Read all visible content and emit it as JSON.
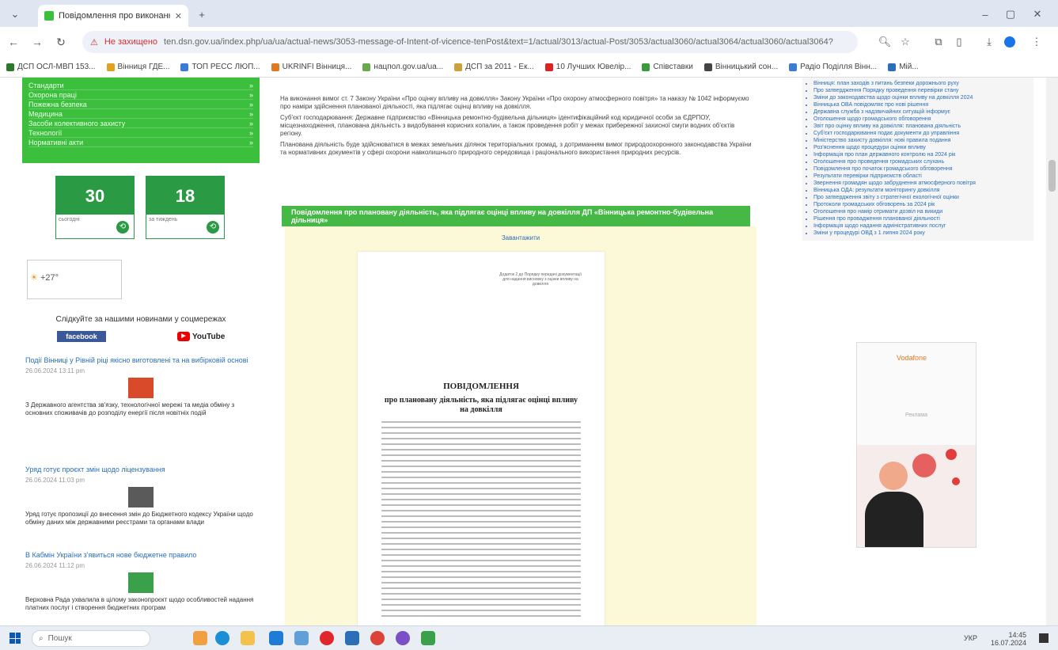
{
  "browser": {
    "tab_title": "Повідомлення про виконання",
    "new_tab": "+",
    "address_warning": "Не захищено",
    "address_url": "ten.dsn.gov.ua/index.php/ua/ua/actual-news/3053-message-of-Intent-of-vicence-tenPost&text=1/actual/3013/actual-Post/3053/actual3060/actual3064/actual3060/actual3064?",
    "bookmarks": [
      {
        "label": "ДСП ОСЛ-МВП 153...",
        "color": "#2b7a2b"
      },
      {
        "label": "Вінниця ГДЕ...",
        "color": "#e0a020"
      },
      {
        "label": "ТОП РЕСС ЛЮП...",
        "color": "#3a7bd5"
      },
      {
        "label": "UKRINFI Вінниця...",
        "color": "#e07a20"
      },
      {
        "label": "нацпол.gov.ua/ua...",
        "color": "#6aa84f"
      },
      {
        "label": "ДСП за 2011 - Ек...",
        "color": "#caa13a"
      },
      {
        "label": "10 Лучших Ювелір...",
        "color": "#d22"
      },
      {
        "label": "Співставки",
        "color": "#3b9a3b"
      },
      {
        "label": "Вінницький сон...",
        "color": "#444"
      },
      {
        "label": "Радіо Поділля Вінн...",
        "color": "#3a7bd5"
      },
      {
        "label": "Мій...",
        "color": "#2a6fb7"
      }
    ]
  },
  "left": {
    "menu_items": [
      "Стандарти",
      "Охорона праці",
      "Пожежна безпека",
      "Медицина",
      "Засоби колективного захисту",
      "Технології",
      "Нормативні акти"
    ],
    "counters": [
      {
        "num": "30",
        "foot": "сьогодні"
      },
      {
        "num": "18",
        "foot": "за тиждень"
      }
    ],
    "weather_temp": "+27°",
    "follow_text": "Слідкуйте за нашими новинами у соцмережах",
    "facebook": "facebook",
    "youtube": "YouTube",
    "youtube_play": "▶",
    "news": [
      {
        "title": "Події Вінниці у Рівній ріці якісно виготовлені та на вибірковій основі",
        "date": "26.06.2024 13:11 pm",
        "text": "З Державного агентства зв'язку, технологічної мережі та медіа обміну з основних споживачів до розподілу енергії після новітніх подій"
      },
      {
        "title": "Уряд готує проєкт змін щодо ліцензування",
        "date": "26.06.2024 11:03 pm",
        "text": "Уряд готує пропозиції до внесення змін до Бюджетного кодексу України щодо обміну даних між державними реєстрами та органами влади"
      },
      {
        "title": "В Кабмін України з'явиться нове бюджетне правило",
        "date": "26.06.2024 11:12 pm",
        "text": "Верховна Рада ухвалила в цілому законопроєкт щодо особливостей надання платних послуг і створення бюджетних програм"
      }
    ]
  },
  "main": {
    "intro": [
      "На виконання вимог ст. 7 Закону України «Про оцінку впливу на довкілля» Закону України «Про охорону атмосферного повітря» та наказу № 1042 інформуємо про наміри здійснення планованої діяльності, яка підлягає оцінці впливу на довкілля.",
      "Суб'єкт господарювання: Державне підприємство «Вінницька ремонтно-будівельна дільниця» ідентифікаційний код юридичної особи за ЄДРПОУ, місцезнаходження, планована діяльність з видобування корисних копалин, а також проведення робіт у межах прибережної захисної смуги водних об'єктів регіону.",
      "Планована діяльність буде здійснюватися в межах земельних ділянок територіальних громад, з дотриманням вимог природоохоронного законодавства України та нормативних документів у сфері охорони навколишнього природного середовища і раціонального використання природних ресурсів."
    ],
    "notice_title": "Повідомлення про плановану діяльність, яка підлягає оцінці впливу на довкілля ДП «Вінницька ремонтно-будівельна дільниця»",
    "doc_link": "Завантажити",
    "doc_appendix": "Додаток 2 до Порядку передачі документації для надання висновку з оцінки впливу на довкілля",
    "doc_heading": "ПОВІДОМЛЕННЯ",
    "doc_subheading": "про плановану діяльність, яка підлягає оцінці впливу на довкілля"
  },
  "right": {
    "links": [
      "Вінниця: план заходів з питань безпеки дорожнього руху",
      "Про затвердження Порядку проведення перевірки стану",
      "Зміни до законодавства щодо оцінки впливу на довкілля 2024",
      "Вінницька ОВА повідомляє про нові рішення",
      "Державна служба з надзвичайних ситуацій інформує",
      "Оголошення щодо громадського обговорення",
      "Звіт про оцінку впливу на довкілля: планована діяльність",
      "Суб'єкт господарювання подає документи до управління",
      "Міністерство захисту довкілля: нові правила подання",
      "Роз'яснення щодо процедури оцінки впливу",
      "Інформація про план державного контролю на 2024 рік",
      "Оголошення про проведення громадських слухань",
      "Повідомлення про початок громадського обговорення",
      "Результати перевірки підприємств області",
      "Звернення громадян щодо забруднення атмосферного повітря",
      "Вінницька ОДА: результати моніторингу довкілля",
      "Про затвердження звіту з стратегічної екологічної оцінки",
      "Протоколи громадських обговорень за 2024 рік",
      "Оголошення про намір отримати дозвіл на викиди",
      "Рішення про провадження планованої діяльності",
      "Інформація щодо надання адміністративних послуг",
      "Зміни у процедурі ОВД з 1 липня 2024 року"
    ],
    "ad_logo": "Vodafone",
    "ad_caption": "Реклама"
  },
  "taskbar": {
    "search": "Пошук",
    "clock_time": "14:45",
    "clock_date": "16.07.2024",
    "tray_lang": "УКР"
  },
  "colors": {
    "green_menu": "#3cbf3c",
    "counter_green": "#2b9a44",
    "notice_bar": "#45b845",
    "doc_bg": "#fcf9d8",
    "link_blue": "#2a6fb7"
  }
}
